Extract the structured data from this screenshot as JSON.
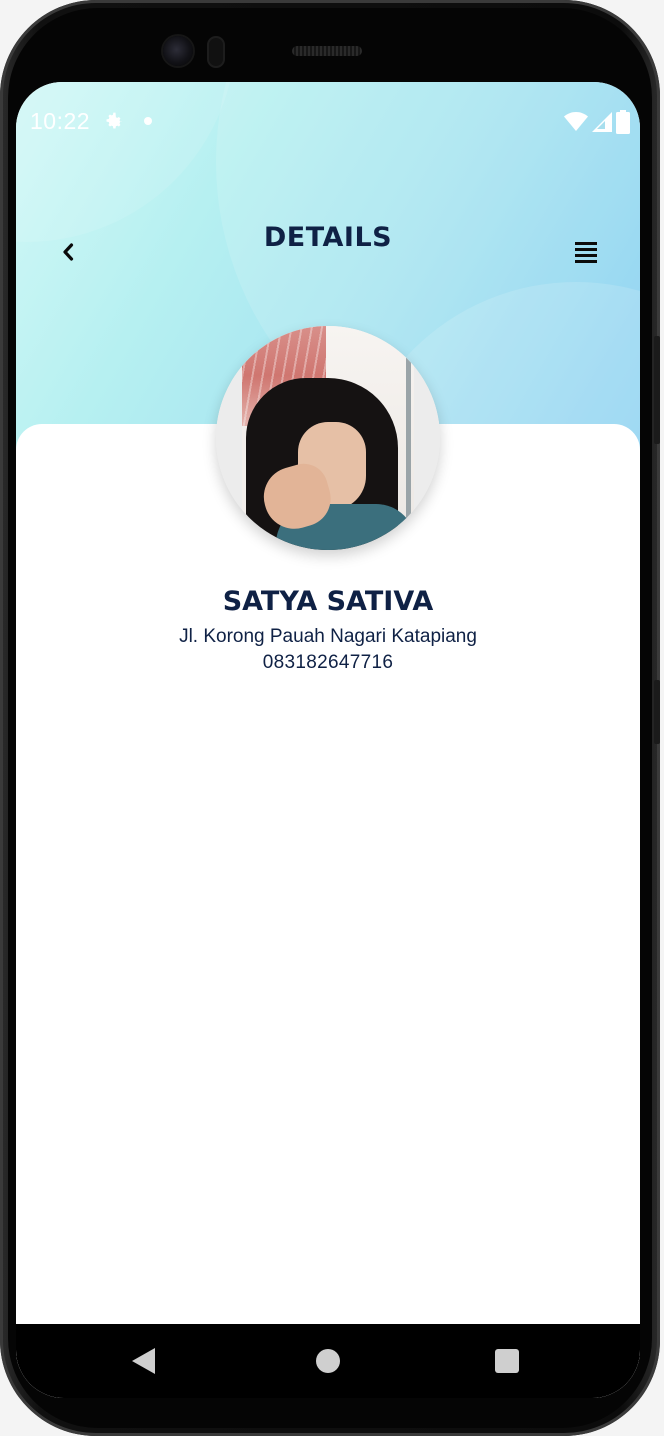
{
  "status_bar": {
    "time": "10:22",
    "icons": [
      "gear-icon",
      "notification-dot-icon",
      "wifi-icon",
      "cellular-signal-icon",
      "battery-icon"
    ]
  },
  "app_bar": {
    "title": "DETAILS",
    "back_icon": "chevron-left-icon",
    "menu_icon": "menu-lines-icon"
  },
  "profile": {
    "name": "SATYA SATIVA",
    "address": "Jl. Korong Pauah Nagari Katapiang",
    "phone": "083182647716"
  },
  "navigation_bar": {
    "icons": [
      "nav-back-icon",
      "nav-home-icon",
      "nav-recents-icon"
    ]
  },
  "colors": {
    "title": "#0f2145",
    "header_gradient_start": "#d3f8f6",
    "header_gradient_end": "#7dcbef",
    "card": "#ffffff",
    "nav_bar": "#000000"
  }
}
